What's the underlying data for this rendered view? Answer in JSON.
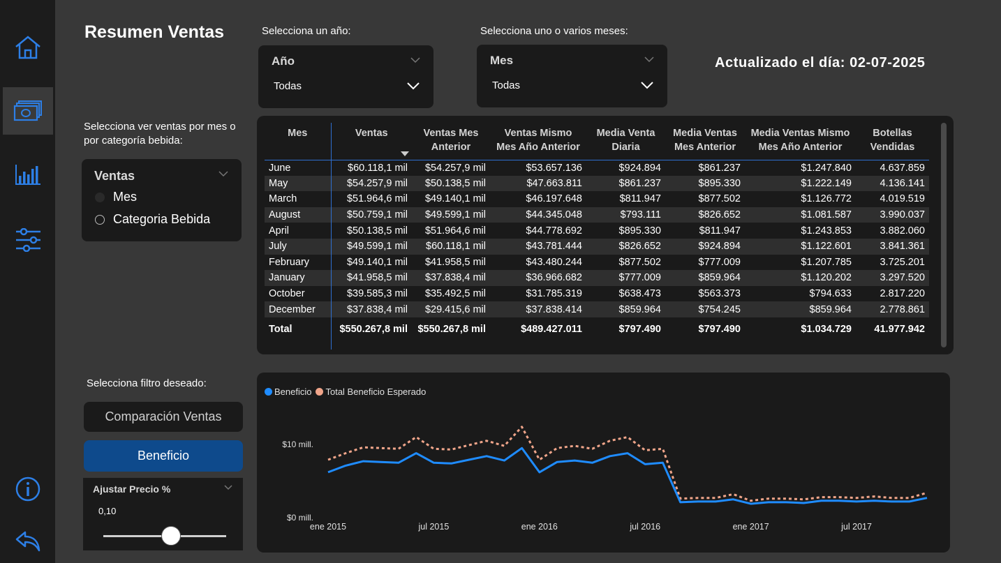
{
  "sidebar": {
    "icons": [
      "home-icon",
      "money-icon",
      "bar-chart-icon",
      "sliders-icon",
      "info-icon",
      "back-icon"
    ]
  },
  "header": {
    "title": "Resumen Ventas",
    "year_prompt": "Selecciona un año:",
    "month_prompt": "Selecciona uno o varios meses:",
    "updated": "Actualizado el día: 02-07-2025"
  },
  "year_filter": {
    "title": "Año",
    "value": "Todas"
  },
  "month_filter": {
    "title": "Mes",
    "value": "Todas"
  },
  "view_selector": {
    "prompt": "Selecciona ver ventas por mes o por categoría bebida:",
    "title": "Ventas",
    "options": [
      "Mes",
      "Categoria Bebida"
    ],
    "selected": "Mes"
  },
  "table": {
    "headers": [
      "Mes",
      "Ventas",
      "Ventas Mes Anterior",
      "Ventas Mismo Mes Año Anterior",
      "Media Venta Diaria",
      "Media Ventas Mes Anterior",
      "Media Ventas Mismo Mes Año Anterior",
      "Botellas Vendidas"
    ],
    "rows": [
      [
        "June",
        "$60.118,1 mil",
        "$54.257,9 mil",
        "$53.657.136",
        "$924.894",
        "$861.237",
        "$1.247.840",
        "4.637.859"
      ],
      [
        "May",
        "$54.257,9 mil",
        "$50.138,5 mil",
        "$47.663.811",
        "$861.237",
        "$895.330",
        "$1.222.149",
        "4.136.141"
      ],
      [
        "March",
        "$51.964,6 mil",
        "$49.140,1 mil",
        "$46.197.648",
        "$811.947",
        "$877.502",
        "$1.126.772",
        "4.019.519"
      ],
      [
        "August",
        "$50.759,1 mil",
        "$49.599,1 mil",
        "$44.345.048",
        "$793.111",
        "$826.652",
        "$1.081.587",
        "3.990.037"
      ],
      [
        "April",
        "$50.138,5 mil",
        "$51.964,6 mil",
        "$44.778.692",
        "$895.330",
        "$811.947",
        "$1.243.853",
        "3.882.060"
      ],
      [
        "July",
        "$49.599,1 mil",
        "$60.118,1 mil",
        "$43.781.444",
        "$826.652",
        "$924.894",
        "$1.122.601",
        "3.841.361"
      ],
      [
        "February",
        "$49.140,1 mil",
        "$41.958,5 mil",
        "$43.480.244",
        "$877.502",
        "$777.009",
        "$1.207.785",
        "3.725.201"
      ],
      [
        "January",
        "$41.958,5 mil",
        "$37.838,4 mil",
        "$36.966.682",
        "$777.009",
        "$859.964",
        "$1.120.202",
        "3.297.520"
      ],
      [
        "October",
        "$39.585,3 mil",
        "$35.492,5 mil",
        "$31.785.319",
        "$638.473",
        "$563.373",
        "$794.633",
        "2.817.220"
      ],
      [
        "December",
        "$37.838,4 mil",
        "$29.415,6 mil",
        "$37.838.414",
        "$859.964",
        "$754.245",
        "$859.964",
        "2.778.861"
      ]
    ],
    "total": [
      "Total",
      "$550.267,8 mil",
      "$550.267,8 mil",
      "$489.427.011",
      "$797.490",
      "$797.490",
      "$1.034.729",
      "41.977.942"
    ]
  },
  "filter_panel": {
    "prompt": "Selecciona filtro deseado:",
    "button_comparacion": "Comparación Ventas",
    "button_beneficio": "Beneficio",
    "slider_title": "Ajustar Precio %",
    "slider_value": "0,10",
    "slider_level": 0.55
  },
  "colors": {
    "beneficio": "#1f8cff",
    "esperado": "#f0a58a",
    "accent": "#0e4a8c"
  },
  "chart_data": {
    "type": "line",
    "legend": [
      "Beneficio",
      "Total Beneficio Esperado"
    ],
    "x_ticks": [
      "ene 2015",
      "jul 2015",
      "ene 2016",
      "jul 2016",
      "ene 2017",
      "jul 2017"
    ],
    "y_ticks": [
      "$0 mill.",
      "$10 mill."
    ],
    "ylim": [
      0,
      14
    ],
    "x": [
      "2015-01",
      "2015-02",
      "2015-03",
      "2015-04",
      "2015-05",
      "2015-06",
      "2015-07",
      "2015-08",
      "2015-09",
      "2015-10",
      "2015-11",
      "2015-12",
      "2016-01",
      "2016-02",
      "2016-03",
      "2016-04",
      "2016-05",
      "2016-06",
      "2016-07",
      "2016-08",
      "2016-09",
      "2016-10",
      "2016-11",
      "2016-12",
      "2017-01",
      "2017-02",
      "2017-03",
      "2017-04",
      "2017-05",
      "2017-06",
      "2017-07",
      "2017-08",
      "2017-09",
      "2017-10",
      "2017-11"
    ],
    "series": [
      {
        "name": "Beneficio",
        "values": [
          6.2,
          7.1,
          7.7,
          7.6,
          7.5,
          8.8,
          7.5,
          7.4,
          7.9,
          8.4,
          7.8,
          9.5,
          6.2,
          7.6,
          7.8,
          7.5,
          8.4,
          8.8,
          7.3,
          7.5,
          2.1,
          2.2,
          2.2,
          2.5,
          1.9,
          2.1,
          2.1,
          2.0,
          2.3,
          2.3,
          2.2,
          2.3,
          2.2,
          2.2,
          2.7
        ]
      },
      {
        "name": "Total Beneficio Esperado",
        "values": [
          7.9,
          8.8,
          9.6,
          9.5,
          9.4,
          11.0,
          9.4,
          9.3,
          9.9,
          10.5,
          9.8,
          12.4,
          7.9,
          9.5,
          9.8,
          9.4,
          10.5,
          11.0,
          9.2,
          9.4,
          2.6,
          2.7,
          2.7,
          3.2,
          2.3,
          2.6,
          2.6,
          2.5,
          2.8,
          2.8,
          2.7,
          2.9,
          2.7,
          2.7,
          3.4
        ]
      }
    ]
  }
}
